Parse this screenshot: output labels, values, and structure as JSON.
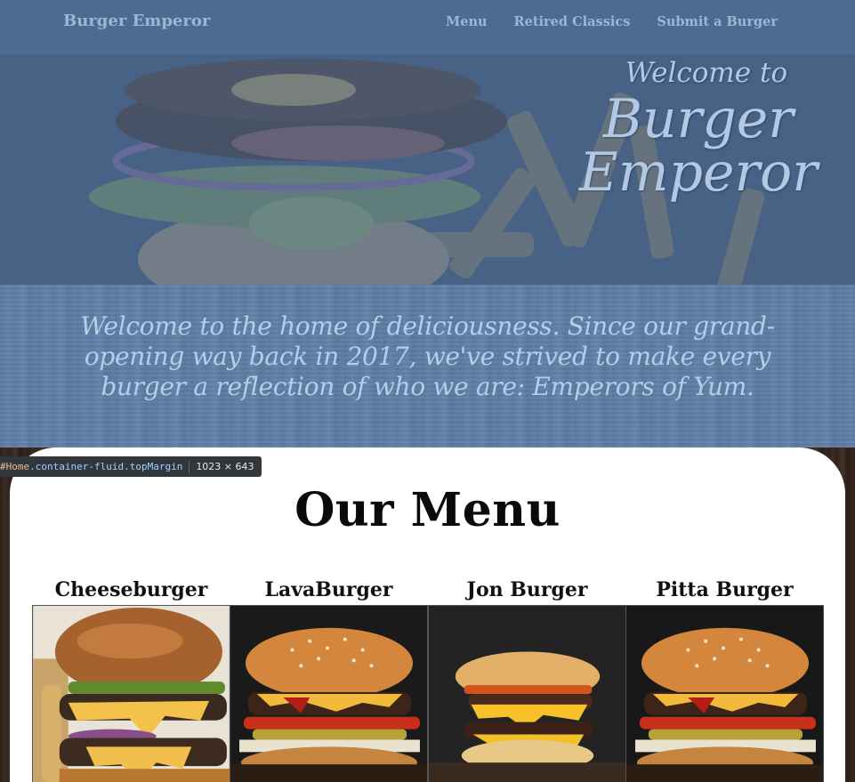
{
  "navbar": {
    "brand": "Burger Emperor",
    "links": [
      "Menu",
      "Retired Classics",
      "Submit a Burger"
    ]
  },
  "hero": {
    "welcome_small": "Welcome to",
    "welcome_line1": "Burger",
    "welcome_line2": "Emperor"
  },
  "intro": {
    "text": "Welcome to the home of deliciousness. Since our grand-opening way back in 2017, we've strived to make every burger a reflection of who we are: Emperors of Yum."
  },
  "menu": {
    "title": "Our Menu",
    "items": [
      {
        "name": "Cheeseburger"
      },
      {
        "name": "LavaBurger"
      },
      {
        "name": "Jon Burger"
      },
      {
        "name": "Pitta Burger"
      }
    ]
  },
  "devtools": {
    "selector_id": "#Home",
    "selector_classes": ".container-fluid.topMargin",
    "dimensions": "1023 × 643"
  },
  "colors": {
    "navbar_bg": "#4d6b8f",
    "nav_text": "#9bb6d6",
    "intro_text": "#b6cde8",
    "card_bg": "#ffffff"
  }
}
